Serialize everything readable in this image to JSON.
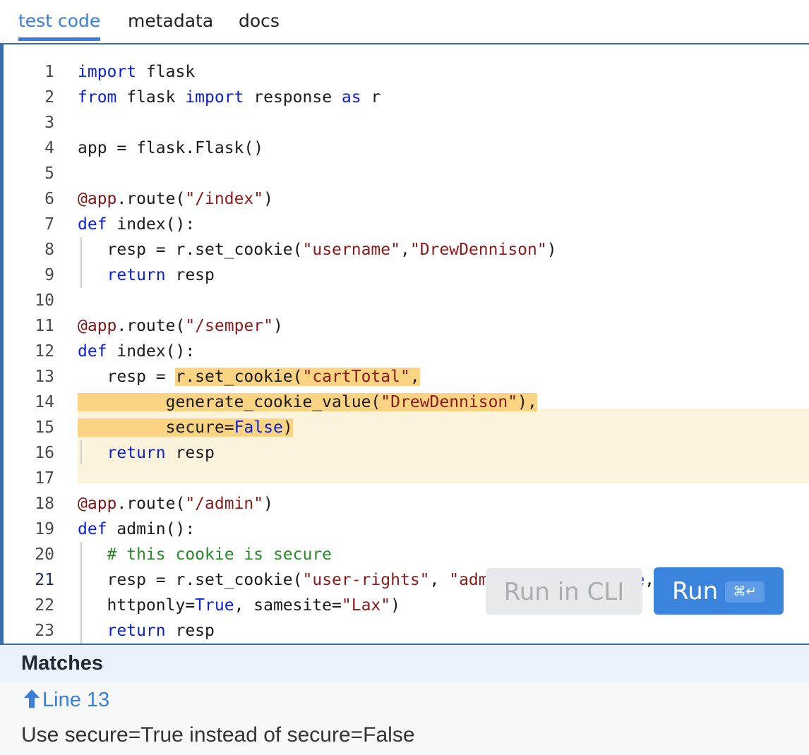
{
  "tabs": [
    {
      "label": "test code",
      "active": true
    },
    {
      "label": "metadata",
      "active": false
    },
    {
      "label": "docs",
      "active": false
    }
  ],
  "editor": {
    "current_line": 21,
    "lines": [
      {
        "n": "1",
        "tokens": [
          {
            "t": "import",
            "c": "kw"
          },
          {
            "t": " flask"
          }
        ]
      },
      {
        "n": "2",
        "tokens": [
          {
            "t": "from",
            "c": "kw"
          },
          {
            "t": " flask "
          },
          {
            "t": "import",
            "c": "kw"
          },
          {
            "t": " response "
          },
          {
            "t": "as",
            "c": "kw"
          },
          {
            "t": " r"
          }
        ]
      },
      {
        "n": "3",
        "tokens": []
      },
      {
        "n": "4",
        "tokens": [
          {
            "t": "app = flask.Flask()"
          }
        ]
      },
      {
        "n": "5",
        "tokens": []
      },
      {
        "n": "6",
        "tokens": [
          {
            "t": "@app",
            "c": "dec"
          },
          {
            "t": ".route("
          },
          {
            "t": "\"/index\"",
            "c": "str"
          },
          {
            "t": ")"
          }
        ]
      },
      {
        "n": "7",
        "tokens": [
          {
            "t": "def",
            "c": "kw"
          },
          {
            "t": " index():"
          }
        ]
      },
      {
        "n": "8",
        "tokens": [
          {
            "t": "   resp = r.set_cookie("
          },
          {
            "t": "\"username\"",
            "c": "str"
          },
          {
            "t": ","
          },
          {
            "t": "\"DrewDennison\"",
            "c": "str"
          },
          {
            "t": ")"
          }
        ]
      },
      {
        "n": "9",
        "tokens": [
          {
            "t": "   "
          },
          {
            "t": "return",
            "c": "kw"
          },
          {
            "t": " resp"
          }
        ]
      },
      {
        "n": "10",
        "tokens": []
      },
      {
        "n": "11",
        "tokens": [
          {
            "t": "@app",
            "c": "dec"
          },
          {
            "t": ".route("
          },
          {
            "t": "\"/semper\"",
            "c": "str"
          },
          {
            "t": ")"
          }
        ]
      },
      {
        "n": "12",
        "tokens": [
          {
            "t": "def",
            "c": "kw"
          },
          {
            "t": " index():"
          }
        ]
      },
      {
        "n": "13",
        "tokens": [
          {
            "t": "   resp = "
          },
          {
            "t": "r.set_cookie(",
            "h": 1
          },
          {
            "t": "\"cartTotal\"",
            "c": "str",
            "h": 1
          },
          {
            "t": ",",
            "h": 1
          }
        ]
      },
      {
        "n": "14",
        "tokens": [
          {
            "t": "         generate_cookie_value(",
            "h": 1
          },
          {
            "t": "\"DrewDennison\"",
            "c": "str",
            "h": 1
          },
          {
            "t": "),",
            "h": 1
          }
        ]
      },
      {
        "n": "15",
        "tokens": [
          {
            "t": "         secure=",
            "h": 1
          },
          {
            "t": "False",
            "c": "kw",
            "h": 1
          },
          {
            "t": ")",
            "h": 1
          }
        ]
      },
      {
        "n": "16",
        "tokens": [
          {
            "t": "   "
          },
          {
            "t": "return",
            "c": "kw"
          },
          {
            "t": " resp"
          }
        ]
      },
      {
        "n": "17",
        "tokens": []
      },
      {
        "n": "18",
        "tokens": [
          {
            "t": "@app",
            "c": "dec"
          },
          {
            "t": ".route("
          },
          {
            "t": "\"/admin\"",
            "c": "str"
          },
          {
            "t": ")"
          }
        ]
      },
      {
        "n": "19",
        "tokens": [
          {
            "t": "def",
            "c": "kw"
          },
          {
            "t": " admin():"
          }
        ]
      },
      {
        "n": "20",
        "tokens": [
          {
            "t": "   "
          },
          {
            "t": "# this cookie is secure",
            "c": "cmt"
          }
        ]
      },
      {
        "n": "21",
        "tokens": [
          {
            "t": "   resp = r.set_cookie("
          },
          {
            "t": "\"user-rights\"",
            "c": "str"
          },
          {
            "t": ", "
          },
          {
            "t": "\"admin\"",
            "c": "str"
          },
          {
            "t": ", secure="
          },
          {
            "t": "True",
            "c": "kw"
          },
          {
            "t": ","
          }
        ]
      },
      {
        "n": "22",
        "tokens": [
          {
            "t": "   httponly="
          },
          {
            "t": "True",
            "c": "kw"
          },
          {
            "t": ", samesite="
          },
          {
            "t": "\"Lax\"",
            "c": "str"
          },
          {
            "t": ")"
          }
        ]
      },
      {
        "n": "23",
        "tokens": [
          {
            "t": "   "
          },
          {
            "t": "return",
            "c": "kw"
          },
          {
            "t": " resp"
          }
        ]
      }
    ]
  },
  "buttons": {
    "run_cli_label": "Run in CLI",
    "run_label": "Run",
    "run_shortcut": "⌘↵"
  },
  "matches": {
    "title": "Matches",
    "link_label": "Line 13",
    "message": "Use secure=True instead of secure=False"
  },
  "colors": {
    "accent": "#3b7dd8",
    "highlight": "#fad482",
    "highlight_bg": "#fcf3dc",
    "keyword": "#0a1fd6",
    "string": "#8b1a1a",
    "comment": "#2a8a2a"
  }
}
